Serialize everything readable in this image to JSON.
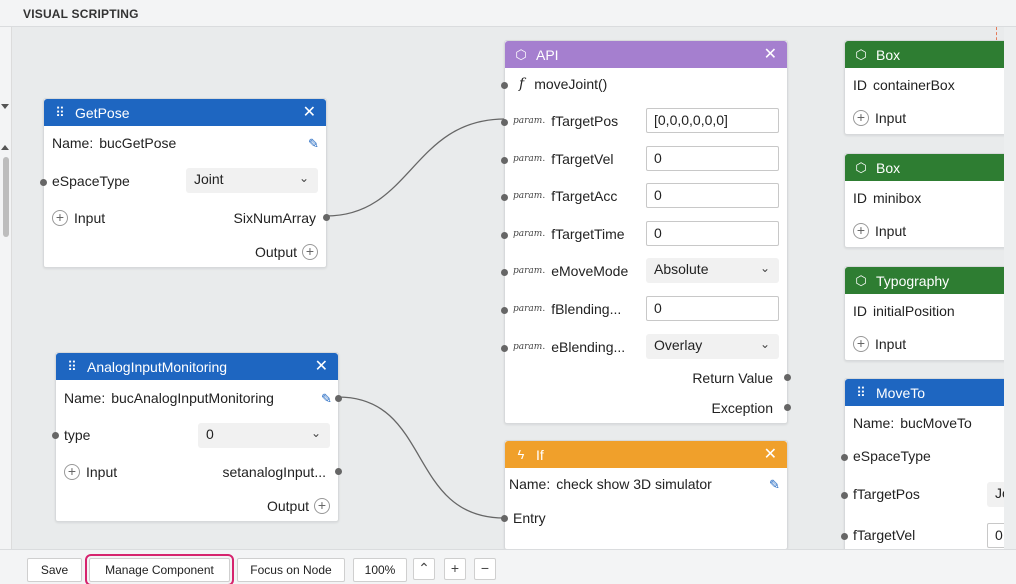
{
  "panel": {
    "title": "VISUAL SCRIPTING"
  },
  "nodes": {
    "getpose": {
      "title": "GetPose",
      "name_label": "Name:",
      "name_value": "bucGetPose",
      "espace_label": "eSpaceType",
      "espace_value": "Joint",
      "input_label": "Input",
      "output_port_label": "SixNumArray",
      "output_label": "Output"
    },
    "analog": {
      "title": "AnalogInputMonitoring",
      "name_label": "Name:",
      "name_value": "bucAnalogInputMonitoring",
      "type_label": "type",
      "type_value": "0",
      "input_label": "Input",
      "output_port_label": "setanalogInput...",
      "output_label": "Output"
    },
    "api": {
      "title": "API",
      "function_name": "moveJoint()",
      "param_tag": "param.",
      "params": [
        {
          "label": "fTargetPos",
          "value": "[0,0,0,0,0,0]",
          "kind": "input"
        },
        {
          "label": "fTargetVel",
          "value": "0",
          "kind": "input"
        },
        {
          "label": "fTargetAcc",
          "value": "0",
          "kind": "input"
        },
        {
          "label": "fTargetTime",
          "value": "0",
          "kind": "input"
        },
        {
          "label": "eMoveMode",
          "value": "Absolute",
          "kind": "select"
        },
        {
          "label": "fBlending...",
          "value": "0",
          "kind": "input"
        },
        {
          "label": "eBlending...",
          "value": "Overlay",
          "kind": "select"
        }
      ],
      "return_label": "Return Value",
      "exception_label": "Exception"
    },
    "if": {
      "title": "If",
      "name_label": "Name:",
      "name_value": "check show 3D simulator",
      "entry_label": "Entry"
    },
    "box1": {
      "title": "Box",
      "id_label": "ID",
      "id_value": "containerBox",
      "input_label": "Input"
    },
    "box2": {
      "title": "Box",
      "id_label": "ID",
      "id_value": "minibox",
      "input_label": "Input"
    },
    "typography": {
      "title": "Typography",
      "id_label": "ID",
      "id_value": "initialPosition",
      "input_label": "Input"
    },
    "moveto": {
      "title": "MoveTo",
      "name_label": "Name:",
      "name_value": "bucMoveTo",
      "espace_label": "eSpaceType",
      "targetpos_label": "fTargetPos",
      "targetpos_value": "Jc",
      "targetvel_label": "fTargetVel",
      "targetvel_value": "0"
    }
  },
  "toolbar": {
    "save_label": "Save",
    "manage_label": "Manage Component",
    "focus_label": "Focus on Node",
    "zoom_value": "100%"
  },
  "colors": {
    "blue": "#1e66c1",
    "purple": "#a57fcf",
    "green": "#2e7d32",
    "orange": "#f0a02b",
    "highlight": "#d6246e"
  }
}
